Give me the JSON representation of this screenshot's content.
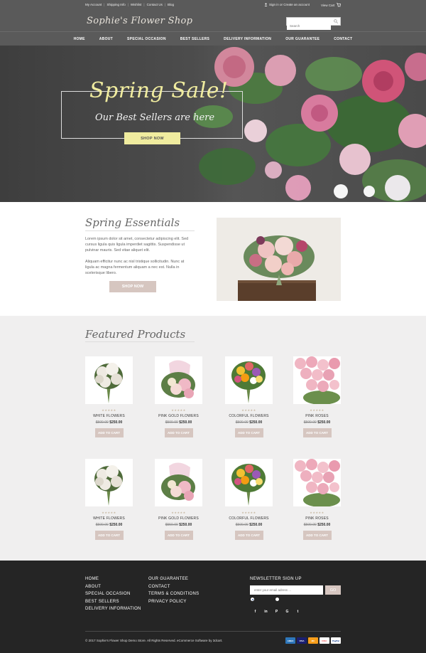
{
  "header": {
    "util_links": [
      "My Account",
      "Shipping Info",
      "Wishlist",
      "Contact Us",
      "Blog"
    ],
    "account_text": "Sign in or Create an account",
    "cart_label": "View Cart",
    "logo": "Sophie's Flower Shop",
    "search_placeholder": "Search"
  },
  "nav": {
    "items": [
      "HOME",
      "ABOUT",
      "SPECIAL OCCASION",
      "BEST SELLERS",
      "DELIVERY INFORMATION",
      "OUR GUARANTEE",
      "CONTACT"
    ]
  },
  "hero": {
    "title": "Spring Sale!",
    "subtitle": "Our Best Sellers are here",
    "button": "SHOP NOW"
  },
  "essentials": {
    "title": "Spring Essentials",
    "paragraph1": "Lorem ipsum dolor sit amet, consectetur adipiscing elit. Sed cursus ligula quis ligula imperdiet sagittis. Suspendisse ut pulvinar mauris. Sed vitae aliquet elit.",
    "paragraph2": "Aliquam efficitur nunc ac nisl tristique sollicitudin. Nunc at ligula ac magna fermentum aliquam a nec est. Nulla in scelerisque libero.",
    "button": "SHOP NOW"
  },
  "featured": {
    "title": "Featured Products",
    "stars": "★★★★★",
    "rows": [
      [
        {
          "name": "WHITE FLOWERS",
          "old_price": "$500.00",
          "price": "$250.00",
          "button": "ADD TO CART",
          "image": "white-bouquet"
        },
        {
          "name": "PINK GOLD FLOWERS",
          "old_price": "$500.00",
          "price": "$250.00",
          "button": "ADD TO CART",
          "image": "pink-gold-bouquet"
        },
        {
          "name": "COLORFUL FLOWERS",
          "old_price": "$500.00",
          "price": "$250.00",
          "button": "ADD TO CART",
          "image": "colorful-bouquet"
        },
        {
          "name": "PINK ROSES",
          "old_price": "$500.00",
          "price": "$250.00",
          "button": "ADD TO CART",
          "image": "pink-roses"
        }
      ],
      [
        {
          "name": "WHITE FLOWERS",
          "old_price": "$500.00",
          "price": "$250.00",
          "button": "ADD TO CART",
          "image": "white-bouquet"
        },
        {
          "name": "PINK GOLD FLOWERS",
          "old_price": "$550.00",
          "price": "$250.00",
          "button": "ADD TO CART",
          "image": "pink-gold-bouquet"
        },
        {
          "name": "COLORFUL FLOWERS",
          "old_price": "$500.00",
          "price": "$250.00",
          "button": "ADD TO CART",
          "image": "colorful-bouquet"
        },
        {
          "name": "PINK ROSES",
          "old_price": "$500.00",
          "price": "$250.00",
          "button": "ADD TO CART",
          "image": "pink-roses"
        }
      ]
    ]
  },
  "footer": {
    "col1": [
      "HOME",
      "ABOUT",
      "SPECIAL OCCASION",
      "BEST SELLERS",
      "DELIVERY INFORMATION"
    ],
    "col2": [
      "OUR GUARANTEE",
      "CONTACT",
      "TERMS & CONDITIONS",
      "PRIVACY POLICY"
    ],
    "newsletter_title": "NEWSLETTER SIGN UP",
    "newsletter_placeholder": "enter your email adress ...",
    "newsletter_button": "GO",
    "social": [
      "f",
      "in",
      "P",
      "G",
      "t"
    ],
    "copyright": "© 2017 Sophie's Flower Shop Demo Store. All Rights Reserved. eCommerce Software by 3dcart.",
    "payments": [
      "AMEX",
      "VISA",
      "MC",
      "DISC",
      "PayPal"
    ]
  },
  "colors": {
    "header_bg": "#5a5a5a",
    "accent_yellow": "#f0ec9f",
    "button_pink": "#d6c6c0",
    "footer_bg": "#252525",
    "featured_bg": "#f0efef"
  }
}
